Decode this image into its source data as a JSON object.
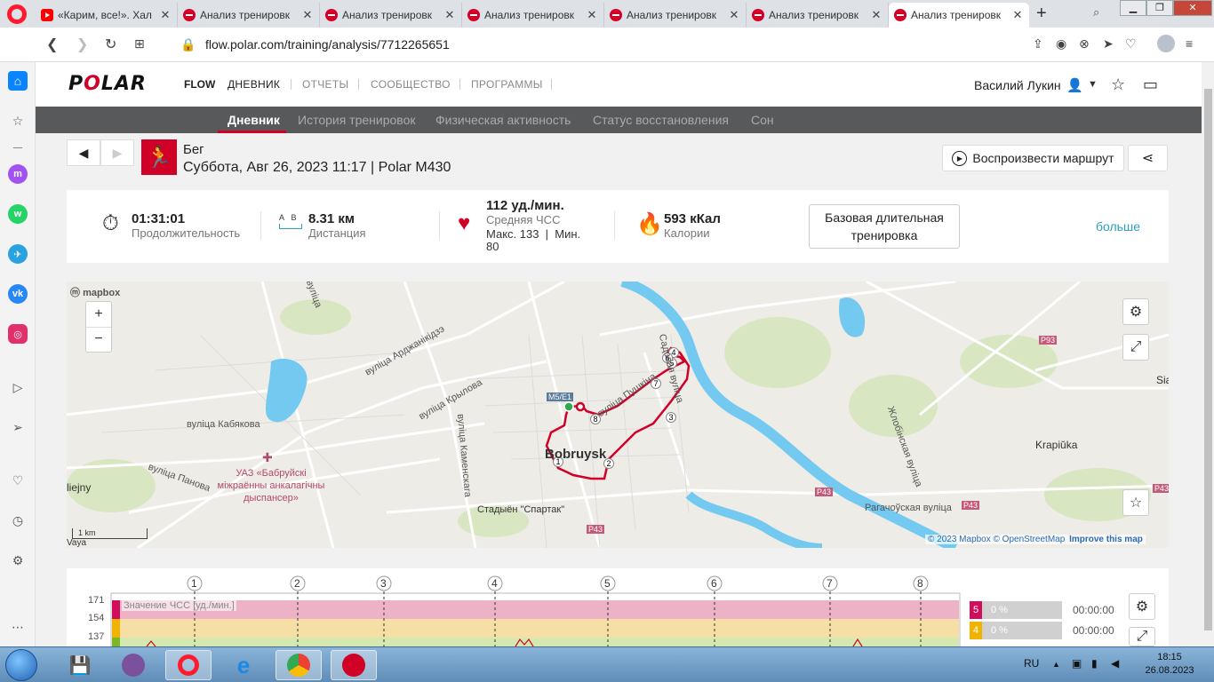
{
  "browser": {
    "tabs": [
      {
        "title": "«Карим, все!». Хал",
        "favicon": "youtube"
      },
      {
        "title": "Анализ тренировк",
        "favicon": "polar"
      },
      {
        "title": "Анализ тренировк",
        "favicon": "polar"
      },
      {
        "title": "Анализ тренировк",
        "favicon": "polar"
      },
      {
        "title": "Анализ тренировк",
        "favicon": "polar"
      },
      {
        "title": "Анализ тренировк",
        "favicon": "polar"
      },
      {
        "title": "Анализ тренировк",
        "favicon": "polar",
        "active": true
      }
    ],
    "url": "flow.polar.com/training/analysis/7712265651"
  },
  "header": {
    "logo": "POLAR",
    "flow": "FLOW",
    "nav": [
      "ДНЕВНИК",
      "ОТЧЕТЫ",
      "СООБЩЕСТВО",
      "ПРОГРАММЫ"
    ],
    "active_nav": "ДНЕВНИК",
    "user": "Василий Лукин"
  },
  "subnav": {
    "items": [
      "Дневник",
      "История тренировок",
      "Физическая активность",
      "Статус восстановления",
      "Сон"
    ],
    "active": "Дневник"
  },
  "session": {
    "sport": "Бег",
    "date": "Суббота, Авг 26, 2023 11:17 | Polar M430",
    "replay_label": "Воспроизвести маршрут"
  },
  "summary": {
    "duration": {
      "value": "01:31:01",
      "label": "Продолжительность"
    },
    "distance": {
      "value": "8.31 км",
      "label": "Дистанция",
      "a": "A",
      "b": "B"
    },
    "hr": {
      "value": "112 уд./мин.",
      "label": "Средняя ЧСС",
      "minmax_line1": "Макс. 133  |  Мин.",
      "minmax_line2": "80"
    },
    "calories": {
      "value": "593 кКал",
      "label": "Калории"
    },
    "training_type_line1": "Базовая длительная",
    "training_type_line2": "тренировка",
    "more": "больше"
  },
  "map": {
    "labels": {
      "city": "Bobruysk",
      "street_ardzhanikidze": "вуліца Арджанікідзэ",
      "street_krylova": "вуліца Крылова",
      "street_kabyakova": "вуліца Кабякова",
      "street_panova": "вуліца Панова",
      "street_kamenskaga": "вуліца Каменскага",
      "street_pushkina": "вуліца Пушкіна",
      "street_sadovaya": "Садовая вуліца",
      "street_zhlobinskaya": "Жлобінская вуліца",
      "street_ragachouskaya": "Рагачоўская вуліца",
      "street_top": "вуліца",
      "hospital_line1": "УАЗ «Бабруйскі",
      "hospital_line2": "міжраённы анкалагічны",
      "hospital_line3": "дыспансер»",
      "stadium": "Стадыён \"Спартак\"",
      "village": "Krapiŭka",
      "edge_left": "liejny",
      "edge_right": "Sia",
      "edge_bottom": "Vaya",
      "road_m5": "M5/E1",
      "road_p93": "P93",
      "road_p43_a": "P43",
      "road_p43_b": "P43",
      "road_p43_c": "P43",
      "road_p43_d": "P43"
    },
    "km_markers": [
      "1",
      "2",
      "3",
      "4",
      "5",
      "6",
      "7",
      "8"
    ],
    "zoom_in": "+",
    "zoom_out": "−",
    "scale": "1 km",
    "mapbox": "mapbox",
    "attribution_copy": "© 2023 Mapbox © OpenStreetMap",
    "attribution_improve": "Improve this map",
    "route_color": "#d10027",
    "water_color": "#74c9f0"
  },
  "hr_chart": {
    "title": "Значение ЧСС [уд./мин.]",
    "y_labels": [
      "171",
      "154",
      "137"
    ],
    "km_markers": [
      "1",
      "2",
      "3",
      "4",
      "5",
      "6",
      "7",
      "8"
    ],
    "zones": [
      {
        "num": "5",
        "percent": "0 %",
        "time": "00:00:00",
        "color": "#d10d5c"
      },
      {
        "num": "4",
        "percent": "0 %",
        "time": "00:00:00",
        "color": "#f0b400"
      }
    ]
  },
  "taskbar": {
    "lang": "RU",
    "time": "18:15",
    "date": "26.08.2023"
  }
}
